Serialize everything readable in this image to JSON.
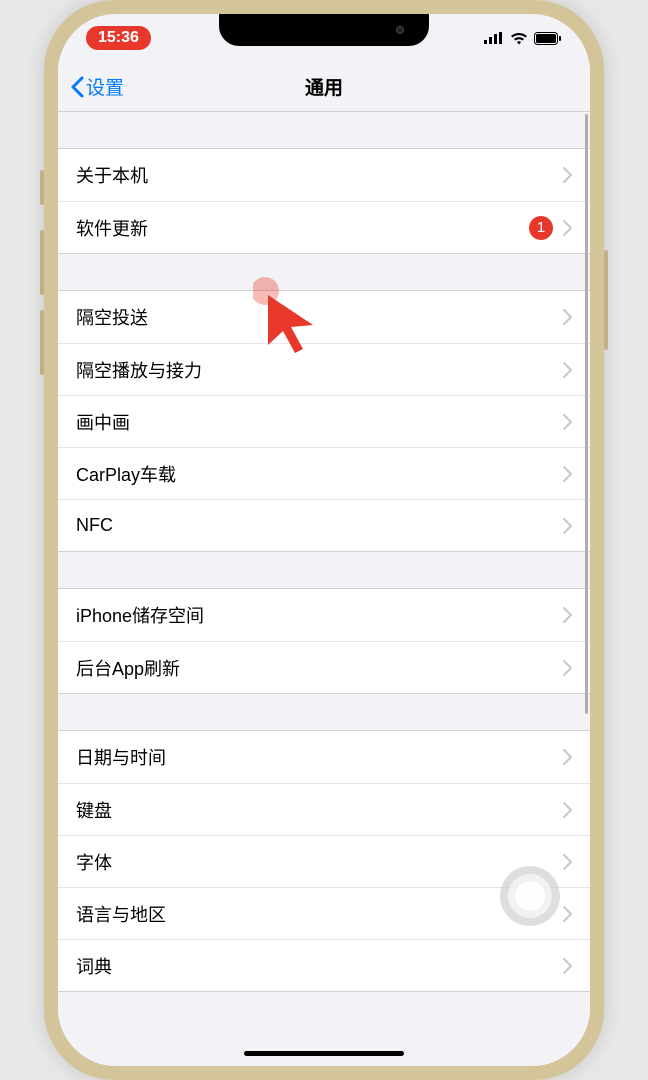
{
  "status": {
    "time": "15:36"
  },
  "nav": {
    "back_label": "设置",
    "title": "通用"
  },
  "groups": [
    {
      "items": [
        {
          "label": "关于本机",
          "badge": null
        },
        {
          "label": "软件更新",
          "badge": "1"
        }
      ]
    },
    {
      "items": [
        {
          "label": "隔空投送",
          "badge": null
        },
        {
          "label": "隔空播放与接力",
          "badge": null
        },
        {
          "label": "画中画",
          "badge": null
        },
        {
          "label": "CarPlay车载",
          "badge": null
        },
        {
          "label": "NFC",
          "badge": null
        }
      ]
    },
    {
      "items": [
        {
          "label": "iPhone储存空间",
          "badge": null
        },
        {
          "label": "后台App刷新",
          "badge": null
        }
      ]
    },
    {
      "items": [
        {
          "label": "日期与时间",
          "badge": null
        },
        {
          "label": "键盘",
          "badge": null
        },
        {
          "label": "字体",
          "badge": null
        },
        {
          "label": "语言与地区",
          "badge": null
        },
        {
          "label": "词典",
          "badge": null
        }
      ]
    }
  ]
}
